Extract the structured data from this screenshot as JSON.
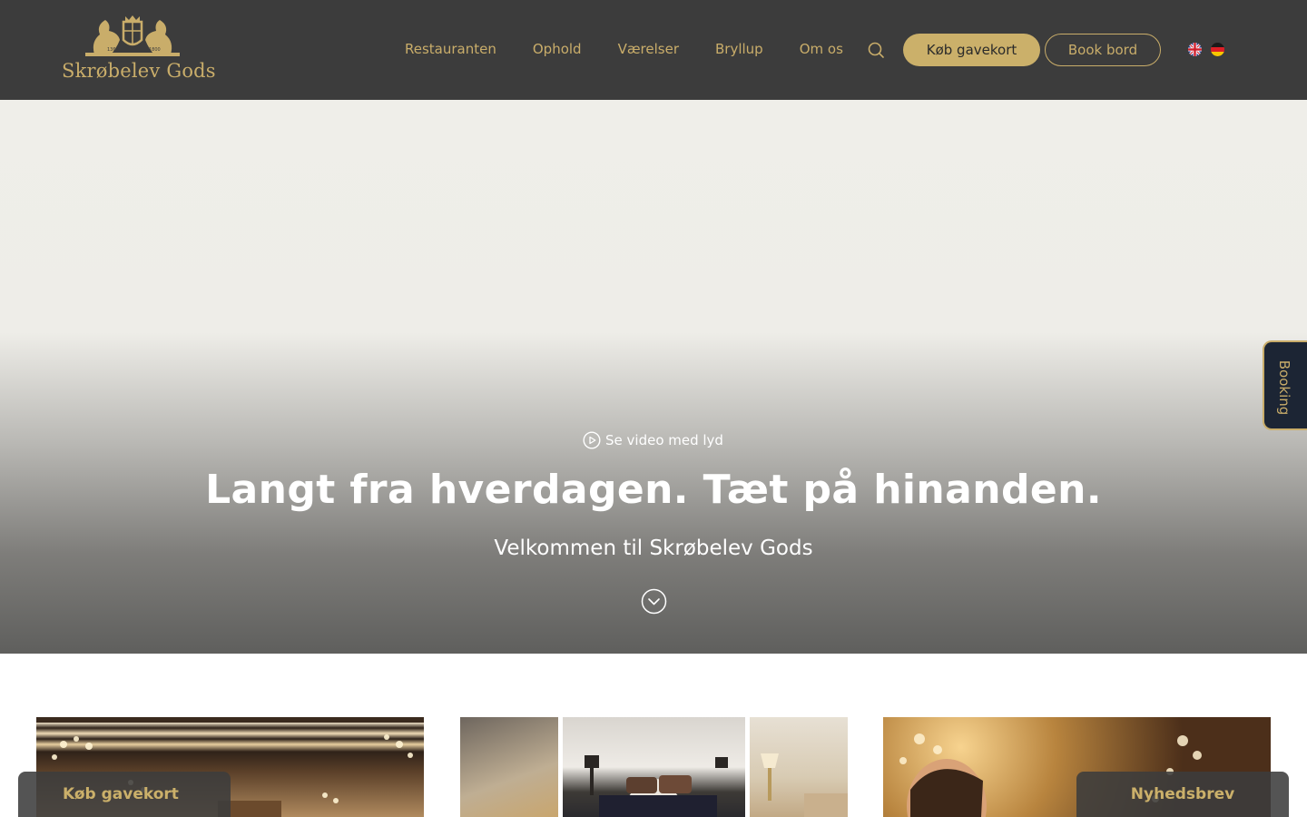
{
  "brand": {
    "name": "Skrøbelev Gods",
    "crest_left_text": "1367",
    "crest_right_text": "1800"
  },
  "nav": {
    "items": [
      "Restauranten",
      "Ophold",
      "Værelser",
      "Bryllup",
      "Om os"
    ]
  },
  "header": {
    "search_icon": "search-icon",
    "gift_button": "Køb gavekort",
    "book_button": "Book bord",
    "languages": [
      "English",
      "Deutsch"
    ]
  },
  "hero": {
    "video_link": "Se video med lyd",
    "title": "Langt fra hverdagen. Tæt på hinanden.",
    "subtitle": "Velkommen til Skrøbelev Gods"
  },
  "booking_tab": {
    "label": "Booking"
  },
  "sticky": {
    "left": "Køb gavekort",
    "right": "Nyhedsbrev"
  },
  "colors": {
    "header_bg": "#3c3c3c",
    "gold": "#c9ad6a",
    "gold_button": "#cbb06a",
    "booking_bg": "#1c2534"
  }
}
